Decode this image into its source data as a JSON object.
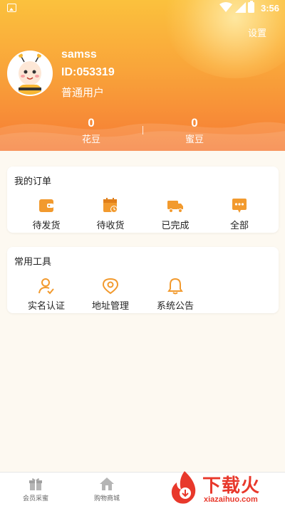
{
  "statusbar": {
    "time": "3:56"
  },
  "header": {
    "settings_label": "设置",
    "username": "samss",
    "user_id": "ID:053319",
    "user_type": "普通用户",
    "stats": [
      {
        "value": "0",
        "label": "花豆"
      },
      {
        "value": "0",
        "label": "蜜豆"
      }
    ]
  },
  "orders": {
    "title": "我的订单",
    "items": [
      {
        "label": "待发货",
        "icon": "wallet-icon"
      },
      {
        "label": "待收货",
        "icon": "calendar-clock-icon"
      },
      {
        "label": "已完成",
        "icon": "truck-icon"
      },
      {
        "label": "全部",
        "icon": "chat-dots-icon"
      }
    ]
  },
  "tools": {
    "title": "常用工具",
    "items": [
      {
        "label": "实名认证",
        "icon": "user-check-icon"
      },
      {
        "label": "地址管理",
        "icon": "location-pin-icon"
      },
      {
        "label": "系统公告",
        "icon": "bell-icon"
      }
    ]
  },
  "bottomnav": {
    "items": [
      {
        "label": "会员采蜜",
        "icon": "gift-icon"
      },
      {
        "label": "购物商城",
        "icon": "home-icon"
      }
    ]
  },
  "watermark": {
    "title": "下载火",
    "url": "xiazaihuo.com"
  },
  "colors": {
    "accent": "#f5a623",
    "header_top": "#fbc13d",
    "header_bottom": "#f67c35",
    "background": "#fdf9f1"
  }
}
